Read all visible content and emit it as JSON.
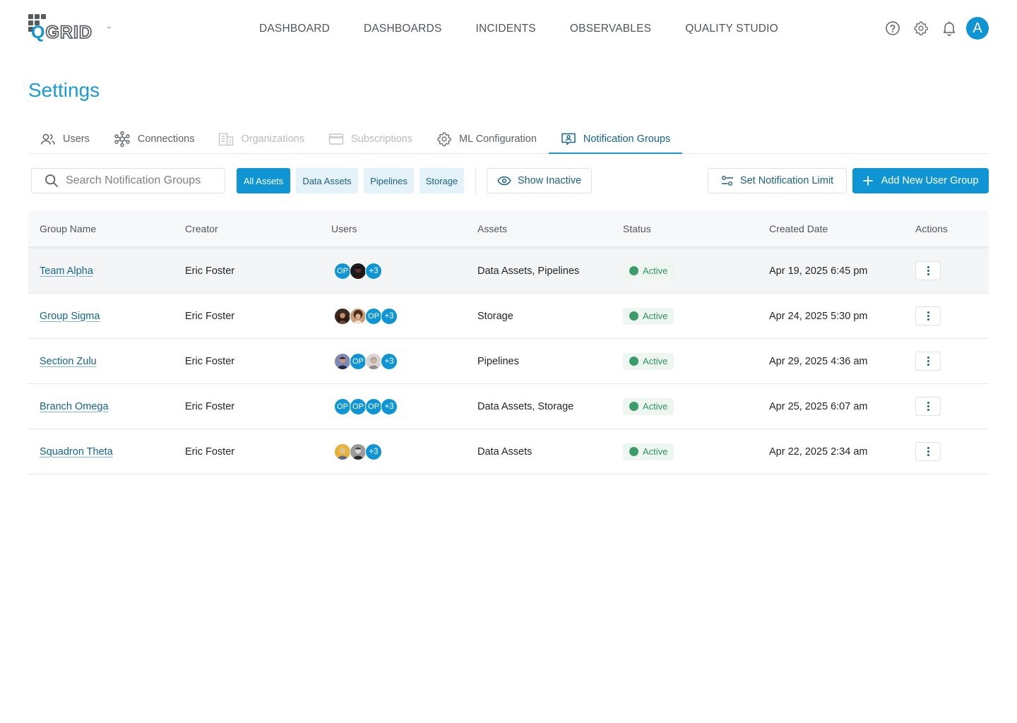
{
  "brand": {
    "logo_q": "Q",
    "logo_rest": "GRID",
    "logo_tm": "™",
    "logo_icon": "grid-dots-logo-icon",
    "accent": "#0f95d4"
  },
  "nav": {
    "items": [
      {
        "label": "DASHBOARD"
      },
      {
        "label": "DASHBOARDS"
      },
      {
        "label": "INCIDENTS"
      },
      {
        "label": "OBSERVABLES"
      },
      {
        "label": "QUALITY STUDIO"
      }
    ]
  },
  "header_icons": [
    "help-icon",
    "settings-gear-icon",
    "notification-bell-icon"
  ],
  "user_avatar": {
    "initial": "A"
  },
  "page": {
    "title": "Settings"
  },
  "tabs": [
    {
      "label": "Users",
      "icon": "users-icon",
      "state": "normal"
    },
    {
      "label": "Connections",
      "icon": "connections-icon",
      "state": "normal"
    },
    {
      "label": "Organizations",
      "icon": "building-icon",
      "state": "disabled"
    },
    {
      "label": "Subscriptions",
      "icon": "credit-card-icon",
      "state": "disabled"
    },
    {
      "label": "ML Configuration",
      "icon": "gear-icon",
      "state": "normal"
    },
    {
      "label": "Notification Groups",
      "icon": "contact-card-icon",
      "state": "active"
    }
  ],
  "toolbar": {
    "search_placeholder": "Search Notification Groups",
    "search_value": "",
    "filters": [
      {
        "label": "All Assets",
        "selected": true
      },
      {
        "label": "Data Assets",
        "selected": false
      },
      {
        "label": "Pipelines",
        "selected": false
      },
      {
        "label": "Storage",
        "selected": false
      }
    ],
    "show_inactive_label": "Show Inactive",
    "set_limit_label": "Set Notification Limit",
    "add_group_label": "Add New User Group"
  },
  "table": {
    "columns": [
      "Group Name",
      "Creator",
      "Users",
      "Assets",
      "Status",
      "Created Date",
      "Actions"
    ],
    "rows": [
      {
        "name": "Team Alpha",
        "creator": "Eric Foster",
        "avatars": [
          "OP",
          "photo-dark"
        ],
        "more": "+3",
        "assets": "Data Assets, Pipelines",
        "status": "Active",
        "created": "Apr 19, 2025 6:45 pm"
      },
      {
        "name": "Group Sigma",
        "creator": "Eric Foster",
        "avatars": [
          "photo-woman",
          "photo-curly",
          "OP"
        ],
        "more": "+3",
        "assets": "Storage",
        "status": "Active",
        "created": "Apr 24, 2025 5:30 pm"
      },
      {
        "name": "Section Zulu",
        "creator": "Eric Foster",
        "avatars": [
          "photo-man",
          "OP",
          "photo-gray"
        ],
        "more": "+3",
        "assets": "Pipelines",
        "status": "Active",
        "created": "Apr 29, 2025 4:36 am"
      },
      {
        "name": "Branch Omega",
        "creator": "Eric Foster",
        "avatars": [
          "OP",
          "OP",
          "OP"
        ],
        "more": "+3",
        "assets": "Data Assets, Storage",
        "status": "Active",
        "created": "Apr 25, 2025 6:07 am"
      },
      {
        "name": "Squadron Theta",
        "creator": "Eric Foster",
        "avatars": [
          "photo-blonde",
          "photo-bw"
        ],
        "more": "+3",
        "assets": "Data Assets",
        "status": "Active",
        "created": "Apr 22, 2025 2:34 am"
      }
    ]
  }
}
